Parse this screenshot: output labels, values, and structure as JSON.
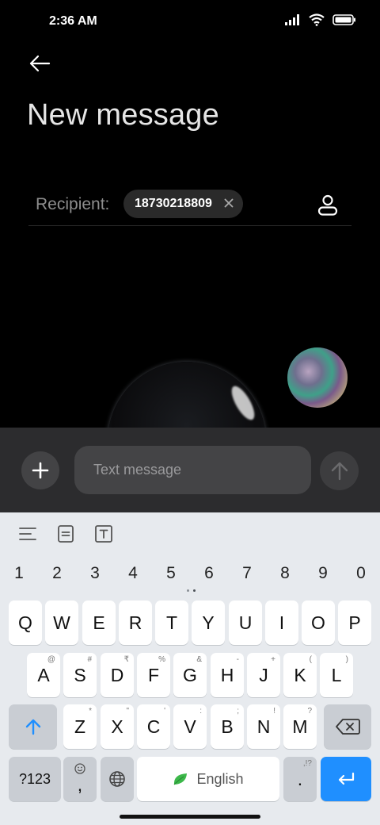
{
  "status_bar": {
    "time": "2:36 AM",
    "icons": [
      "signal-icon",
      "wifi-icon",
      "battery-icon"
    ]
  },
  "header": {
    "back_icon": "back-arrow-icon",
    "title": "New message"
  },
  "recipient": {
    "label": "Recipient:",
    "chip_value": "18730218809",
    "chip_remove_icon": "close-icon",
    "contact_icon": "contact-person-icon"
  },
  "compose": {
    "add_icon": "plus-icon",
    "placeholder": "Text message",
    "send_icon": "send-arrow-icon"
  },
  "keyboard": {
    "toolbar_icons": [
      "menu-lines-icon",
      "clipboard-icon",
      "text-format-icon"
    ],
    "numbers": [
      "1",
      "2",
      "3",
      "4",
      "5",
      "6",
      "7",
      "8",
      "9",
      "0"
    ],
    "row1": [
      "Q",
      "W",
      "E",
      "R",
      "T",
      "Y",
      "U",
      "I",
      "O",
      "P"
    ],
    "row2": [
      {
        "key": "A",
        "hint": "@"
      },
      {
        "key": "S",
        "hint": "#"
      },
      {
        "key": "D",
        "hint": "₹"
      },
      {
        "key": "F",
        "hint": "%"
      },
      {
        "key": "G",
        "hint": "&"
      },
      {
        "key": "H",
        "hint": "-"
      },
      {
        "key": "J",
        "hint": "+"
      },
      {
        "key": "K",
        "hint": "("
      },
      {
        "key": "L",
        "hint": ")"
      }
    ],
    "row3": [
      {
        "key": "Z",
        "hint": "*"
      },
      {
        "key": "X",
        "hint": "\""
      },
      {
        "key": "C",
        "hint": "'"
      },
      {
        "key": "V",
        "hint": ":"
      },
      {
        "key": "B",
        "hint": ";"
      },
      {
        "key": "N",
        "hint": "!"
      },
      {
        "key": "M",
        "hint": "?"
      }
    ],
    "symbols_label": "?123",
    "comma_label": ",",
    "space_label": "English",
    "period_label": ".",
    "period_hint": ",!?",
    "accent_color": "#1f8fff"
  }
}
